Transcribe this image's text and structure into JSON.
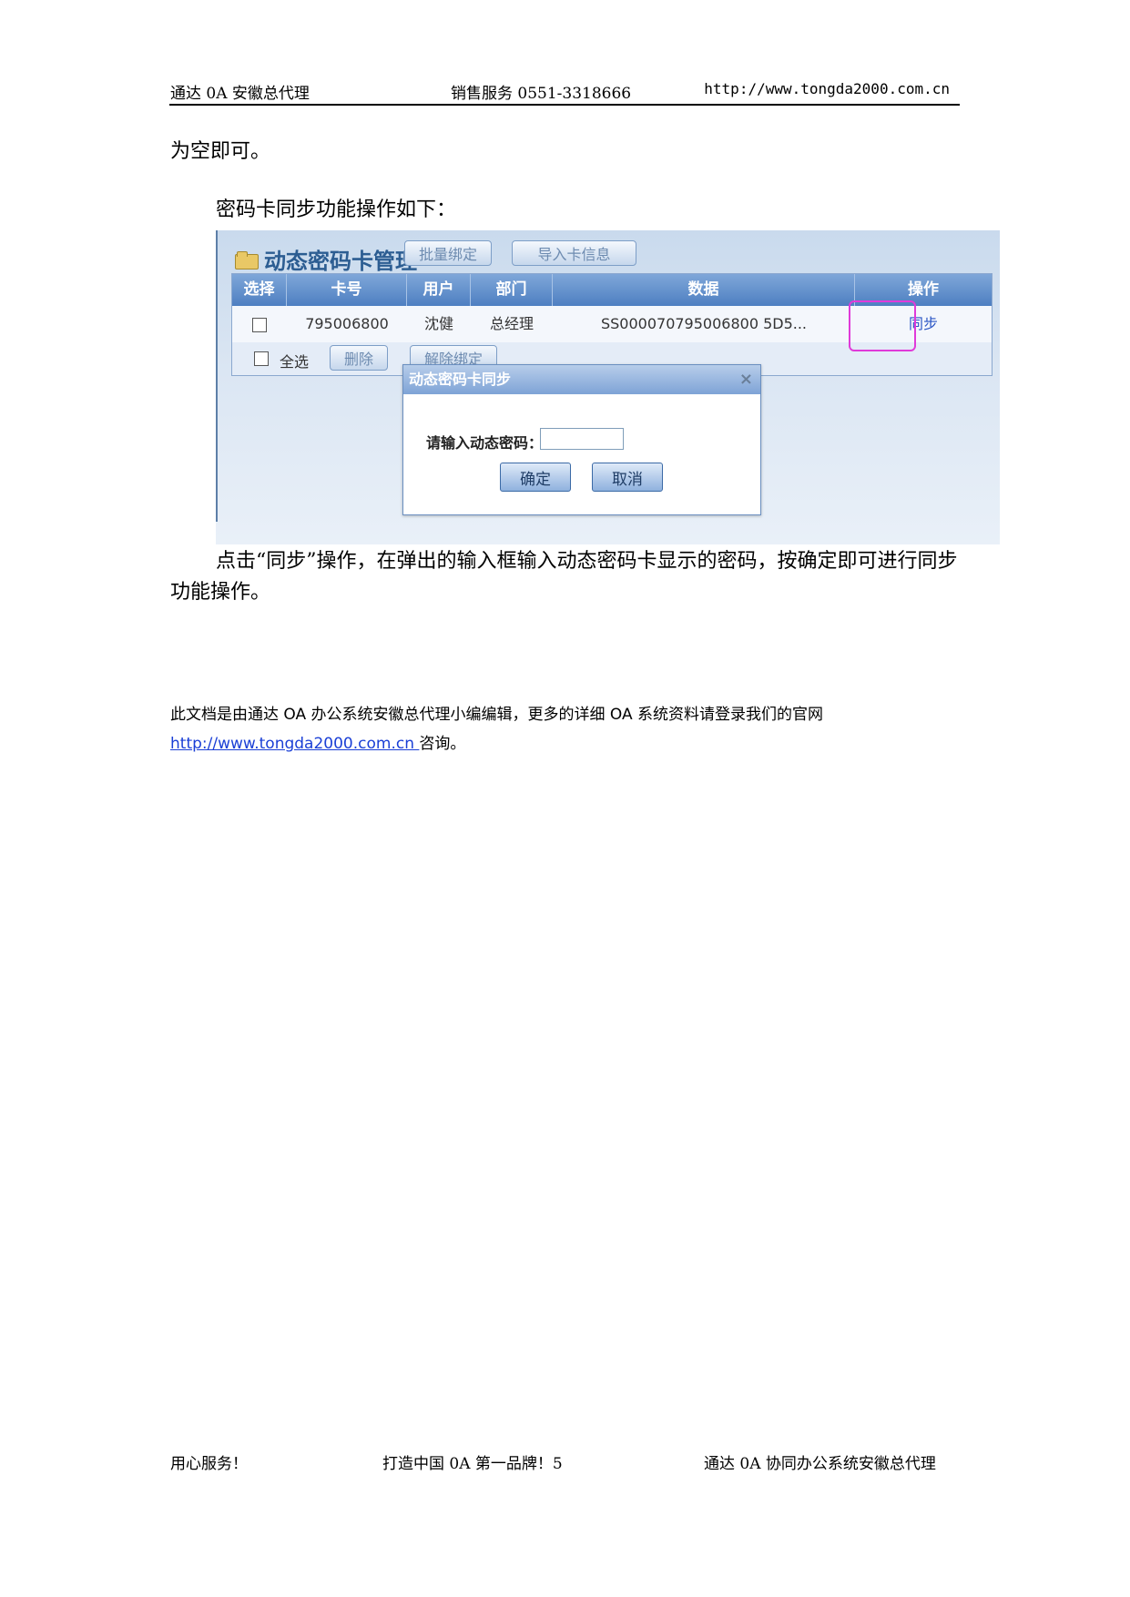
{
  "header": {
    "left": "通达 0A 安徽总代理",
    "center": "销售服务 0551-3318666",
    "right": "http://www.tongda2000.com.cn"
  },
  "body": {
    "p1": "为空即可。",
    "p2": "密码卡同步功能操作如下：",
    "p3": "点击“同步”操作，在弹出的输入框输入动态密码卡显示的密码，按确定即可进行同步功能操作。"
  },
  "screenshot": {
    "panel_title": "动态密码卡管理",
    "buttons": {
      "batch_bind": "批量绑定",
      "import_info": "导入卡信息"
    },
    "columns": [
      "选择",
      "卡号",
      "用户",
      "部门",
      "数据",
      "操作"
    ],
    "row": {
      "card_no": "795006800",
      "user": "沈健",
      "dept": "总经理",
      "data": "SS000070795006800 5D5...",
      "action": "同步"
    },
    "footer": {
      "select_all": "全选",
      "delete": "删除",
      "unbind": "解除绑定"
    },
    "dialog": {
      "title": "动态密码卡同步",
      "close": "×",
      "label": "请输入动态密码：",
      "ok": "确定",
      "cancel": "取消"
    }
  },
  "note": {
    "text": "此文档是由通达 OA 办公系统安徽总代理小编编辑，更多的详细 OA 系统资料请登录我们的官网",
    "link": "http://www.tongda2000.com.cn ",
    "suffix": "咨询。"
  },
  "footer": {
    "left": "用心服务！",
    "center": "打造中国 0A 第一品牌！5",
    "right": "通达 0A 协同办公系统安徽总代理"
  }
}
